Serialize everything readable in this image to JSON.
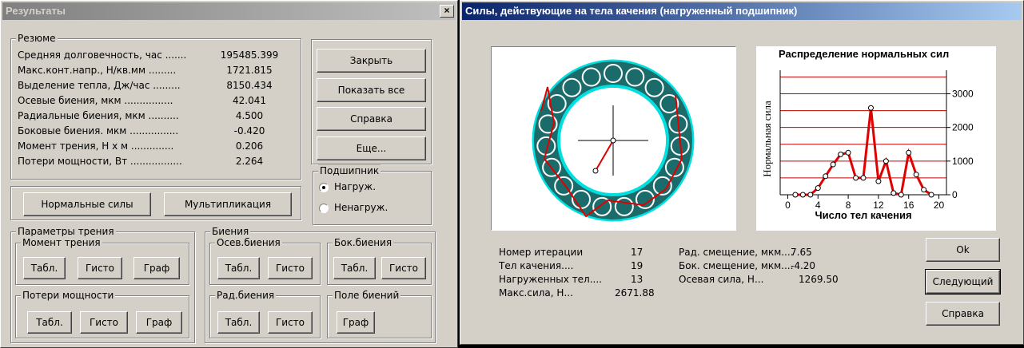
{
  "left_window": {
    "title": "Результаты",
    "close_glyph": "×",
    "summary": {
      "legend": "Резюме",
      "rows": [
        {
          "label": "Средняя долговечность, час .......",
          "value": "195485.399"
        },
        {
          "label": "Макс.конт.напр., Н/кв.мм .........",
          "value": "1721.815"
        },
        {
          "label": "Выделение тепла, Дж/час .........",
          "value": "8150.434"
        },
        {
          "label": "Осевые биения, мкм ................",
          "value": "42.041"
        },
        {
          "label": "Радиальные биения, мкм ..........",
          "value": "4.500"
        },
        {
          "label": "Боковые биения. мкм ................",
          "value": "-0.420"
        },
        {
          "label": "Момент трения, Н х м ..............",
          "value": "0.206"
        },
        {
          "label": "Потери мощности, Вт .................",
          "value": "2.264"
        }
      ]
    },
    "buttons": {
      "close": "Закрыть",
      "show_all": "Показать все",
      "help": "Справка",
      "more": "Еще...",
      "normal_forces": "Нормальные силы",
      "multiplication": "Мультипликация"
    },
    "bearing": {
      "legend": "Подшипник",
      "loaded": "Нагруж.",
      "unloaded": "Ненагруж.",
      "selected": "loaded"
    },
    "friction_params": {
      "legend": "Параметры трения",
      "moment": {
        "legend": "Момент трения",
        "table": "Табл.",
        "histo": "Гисто",
        "graph": "Граф"
      },
      "power_loss": {
        "legend": "Потери мощности",
        "table": "Табл.",
        "histo": "Гисто",
        "graph": "Граф"
      }
    },
    "runout": {
      "legend": "Биения",
      "axial": {
        "legend": "Осев.биения",
        "table": "Табл.",
        "histo": "Гисто"
      },
      "lateral": {
        "legend": "Бок.биения",
        "table": "Табл.",
        "histo": "Гисто"
      },
      "radial": {
        "legend": "Рад.биения",
        "table": "Табл.",
        "histo": "Гисто"
      },
      "field": {
        "legend": "Поле биений",
        "graph": "Граф"
      }
    }
  },
  "right_window": {
    "title": "Силы, действующие на тела качения (нагруженный подшипник)",
    "stats_left": [
      {
        "label": "Номер итерации",
        "value": "17"
      },
      {
        "label": "Тел качения....",
        "value": "19"
      },
      {
        "label": "Нагруженных тел....",
        "value": "13"
      },
      {
        "label": "Макс.сила, Н...",
        "value": "2671.88"
      }
    ],
    "stats_right": [
      {
        "label": "Рад. смещение, мкм....",
        "value": "7.65"
      },
      {
        "label": "Бок. смещение, мкм....",
        "value": "-4.20"
      },
      {
        "label": "Осевая сила, Н...",
        "value": "1269.50"
      }
    ],
    "buttons": {
      "ok": "Ok",
      "next": "Следующий",
      "help": "Справка"
    },
    "colors": {
      "ring": "#1c6b6b",
      "cyan": "#00e0e0",
      "force_line": "#e00000",
      "ball": "#1c6b6b"
    }
  },
  "chart_data": {
    "type": "line",
    "title": "Распределение нормальных сил",
    "xlabel": "Число тел качения",
    "ylabel": "Нормальная сила",
    "x_ticks": [
      "0",
      "4",
      "8",
      "12",
      "16",
      "20"
    ],
    "y_ticks": [
      "0",
      "1000",
      "2000",
      "3000"
    ],
    "xlim": [
      -1,
      21
    ],
    "ylim": [
      0,
      3700
    ],
    "grid": "horizontal",
    "series": [
      {
        "x": [
          1,
          2,
          3,
          4,
          5,
          6,
          7,
          8,
          9,
          10,
          11,
          12,
          13,
          14,
          15,
          16,
          17,
          18,
          19
        ],
        "y": [
          0,
          0,
          0,
          200,
          550,
          900,
          1200,
          1250,
          500,
          500,
          2580,
          400,
          1000,
          50,
          0,
          1250,
          600,
          150,
          0
        ]
      }
    ]
  }
}
